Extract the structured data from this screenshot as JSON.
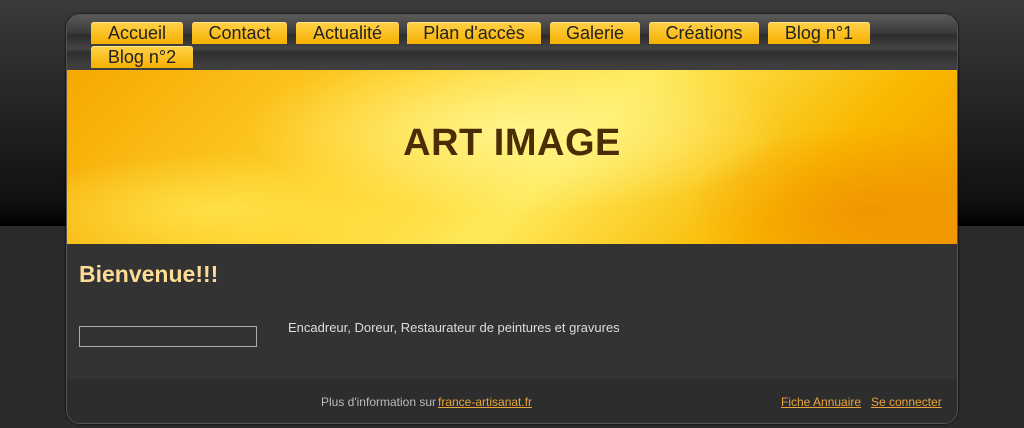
{
  "nav": {
    "tabs": [
      {
        "label": "Accueil"
      },
      {
        "label": "Contact"
      },
      {
        "label": "Actualité"
      },
      {
        "label": "Plan d'accès"
      },
      {
        "label": "Galerie"
      },
      {
        "label": "Créations"
      },
      {
        "label": "Blog n°1"
      },
      {
        "label": "Blog n°2"
      }
    ]
  },
  "banner": {
    "title": "ART IMAGE"
  },
  "main": {
    "heading": "Bienvenue!!!",
    "description": "Encadreur, Doreur, Restaurateur de peintures et gravures",
    "input_value": ""
  },
  "footer": {
    "info_text": "Plus d'information sur",
    "site_link": "france-artisanat.fr",
    "directory_link": "Fiche Annuaire",
    "login_link": "Se connecter"
  },
  "colors": {
    "tab_gold": "#f6b000",
    "heading": "#ffdc96",
    "link": "#e8a43a",
    "banner_title": "#4a2c05"
  }
}
